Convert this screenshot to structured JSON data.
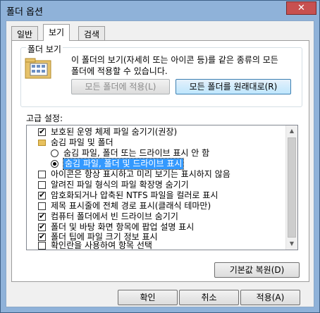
{
  "window": {
    "title": "폴더 옵션",
    "close_symbol": "✕"
  },
  "tabs": [
    {
      "label": "일반",
      "active": false
    },
    {
      "label": "보기",
      "active": true
    },
    {
      "label": "검색",
      "active": false
    }
  ],
  "folder_view": {
    "legend": "폴더 보기",
    "description": "이 폴더의 보기(자세히 또는 아이콘 등)를 같은 종류의 모든 폴더에 적용할 수 있습니다.",
    "apply_button": "모든 폴더에 적용(L)",
    "reset_button": "모든 폴더를 원래대로(R)",
    "icon": "folder-view-icon"
  },
  "advanced": {
    "label": "고급 설정:",
    "items": [
      {
        "type": "checkbox",
        "checked": true,
        "indent": 0,
        "label": "보호된 운영 체제 파일 숨기기(권장)"
      },
      {
        "type": "folder",
        "indent": 0,
        "label": "숨김 파일 및 폴더"
      },
      {
        "type": "radio",
        "checked": false,
        "indent": 1,
        "label": "숨김 파일, 폴더 또는 드라이브 표시 안 함"
      },
      {
        "type": "radio",
        "checked": true,
        "indent": 1,
        "label": "숨김 파일, 폴더 및 드라이브 표시",
        "selected": true
      },
      {
        "type": "checkbox",
        "checked": false,
        "indent": 0,
        "label": "아이콘은 항상 표시하고 미리 보기는 표시하지 않음"
      },
      {
        "type": "checkbox",
        "checked": false,
        "indent": 0,
        "label": "알려진 파일 형식의 파일 확장명 숨기기"
      },
      {
        "type": "checkbox",
        "checked": true,
        "indent": 0,
        "label": "암호화되거나 압축된 NTFS 파일을 컬러로 표시"
      },
      {
        "type": "checkbox",
        "checked": false,
        "indent": 0,
        "label": "제목 표시줄에 전체 경로 표시(클래식 테마만)"
      },
      {
        "type": "checkbox",
        "checked": true,
        "indent": 0,
        "label": "컴퓨터 폴더에서 빈 드라이브 숨기기"
      },
      {
        "type": "checkbox",
        "checked": true,
        "indent": 0,
        "label": "폴더 및 바탕 화면 항목에 팝업 설명 표시"
      },
      {
        "type": "checkbox",
        "checked": true,
        "indent": 0,
        "label": "폴더 팁에 파일 크기 정보 표시"
      },
      {
        "type": "checkbox",
        "checked": false,
        "indent": 0,
        "label": "확인란을 사용하여 항목 선택"
      }
    ],
    "restore_defaults_button": "기본값 복원(D)"
  },
  "footer": {
    "ok": "확인",
    "cancel": "취소",
    "apply": "적용(A)"
  },
  "colors": {
    "selection": "#3399ff",
    "title_bar": "#8fb2d9",
    "close_button": "#c75050"
  }
}
